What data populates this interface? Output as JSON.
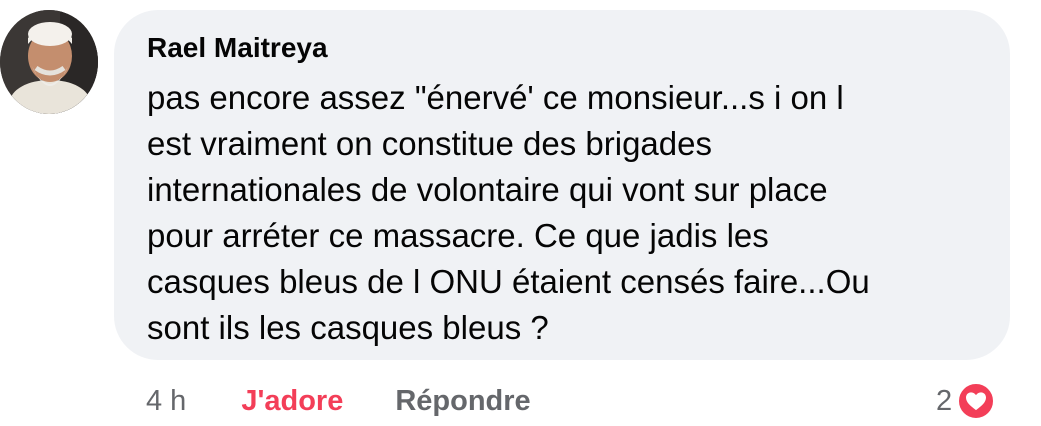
{
  "comment": {
    "author": "Rael Maitreya",
    "message": "pas encore assez \"énervé' ce monsieur...s i on l\nest vraiment on constitue des brigades\ninternationales de volontaire qui vont sur place\npour arréter ce massacre. Ce que jadis les\ncasques bleus de l ONU étaient censés faire...Ou\nsont ils les casques bleus ?",
    "time": "4 h",
    "like_label": "J'adore",
    "reply_label": "Répondre",
    "reaction_count": "2",
    "reaction_icon": "heart-icon"
  },
  "colors": {
    "bubble_bg": "#f0f2f5",
    "reaction_red": "#f33e58",
    "muted_text": "#65676b",
    "primary_text": "#050505"
  }
}
